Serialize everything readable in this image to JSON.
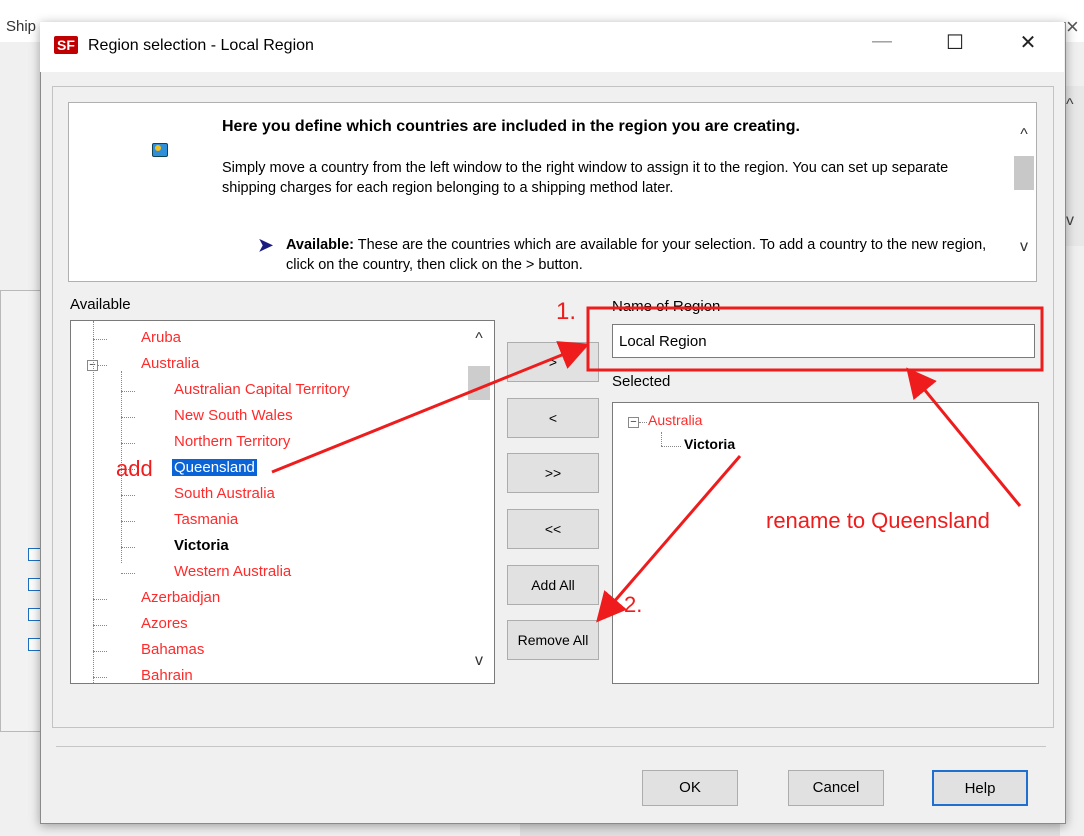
{
  "background_window": {
    "title_fragment": "Ship",
    "close_glyph": "×"
  },
  "dialog": {
    "title": "Region selection - Local Region",
    "app_icon": "SF",
    "minimize_glyph": "—",
    "maximize_glyph": "☐",
    "close_glyph": "✕"
  },
  "info": {
    "heading": "Here you define which countries are included in the region you are creating.",
    "body": "Simply move a country from the left window to the right window to assign it to the region. You can set up separate shipping charges for each region belonging to a shipping method later.",
    "available_bullet": "➤",
    "available_label": "Available:",
    "available_text": " These are the countries which are available for your selection. To add a country to the new region, click on the country, then click on the > button.",
    "scroll_up": "^",
    "scroll_down": "v"
  },
  "available": {
    "label": "Available",
    "items": [
      {
        "text": "Aruba",
        "level": 0
      },
      {
        "text": "Australia",
        "level": 0,
        "expanded": true
      },
      {
        "text": "Australian Capital Territory",
        "level": 1
      },
      {
        "text": "New South Wales",
        "level": 1
      },
      {
        "text": "Northern Territory",
        "level": 1
      },
      {
        "text": "Queensland",
        "level": 1,
        "selected": true
      },
      {
        "text": "South Australia",
        "level": 1
      },
      {
        "text": "Tasmania",
        "level": 1
      },
      {
        "text": "Victoria",
        "level": 1,
        "bold": true
      },
      {
        "text": "Western Australia",
        "level": 1
      },
      {
        "text": "Azerbaidjan",
        "level": 0
      },
      {
        "text": "Azores",
        "level": 0
      },
      {
        "text": "Bahamas",
        "level": 0
      },
      {
        "text": "Bahrain",
        "level": 0
      }
    ],
    "scroll_up": "^",
    "scroll_down": "v"
  },
  "buttons": {
    "add": ">",
    "remove": "<",
    "add_all_arrows": ">>",
    "remove_all_arrows": "<<",
    "add_all": "Add All",
    "remove_all": "Remove All"
  },
  "name_of_region": {
    "label": "Name of Region",
    "value": "Local Region"
  },
  "selected": {
    "label": "Selected",
    "parent": "Australia",
    "child": "Victoria"
  },
  "footer": {
    "ok": "OK",
    "cancel": "Cancel",
    "help": "Help"
  },
  "annotations": {
    "step1": "1.",
    "step2": "2.",
    "add": "add",
    "rename": "rename to Queensland",
    "color": "#ee1c1c"
  },
  "colors": {
    "tree_item": "#ff2b2b",
    "selection": "#0a64d8",
    "help_border": "#1e6fd0"
  }
}
